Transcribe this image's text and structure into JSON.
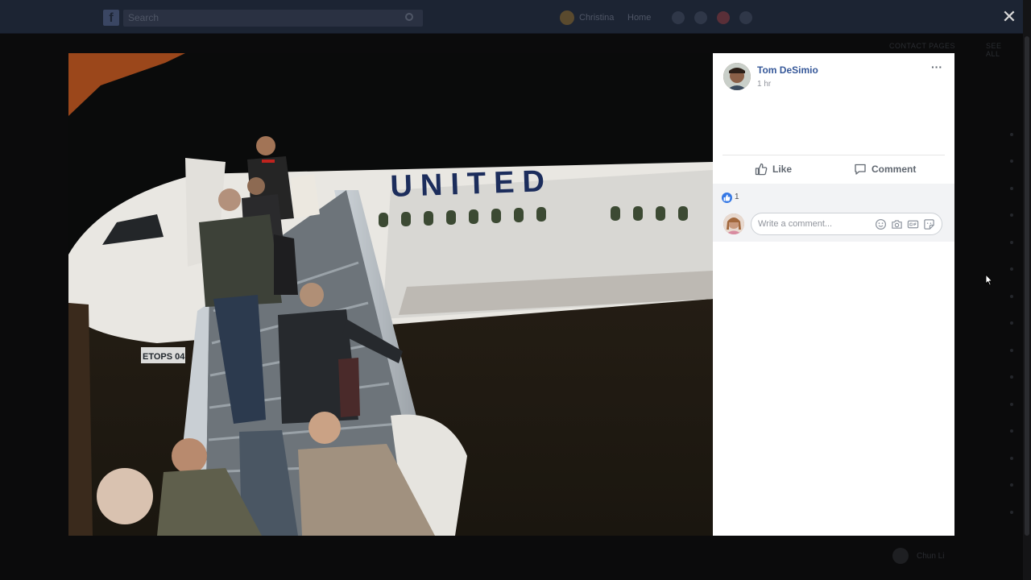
{
  "background": {
    "search_placeholder": "Search",
    "user_name": "Christina",
    "home_label": "Home",
    "contacts_header": "CONTACT PAGES",
    "see_all": "SEE ALL",
    "chat_user": "Chun Li"
  },
  "viewer": {
    "close_label": "✕"
  },
  "photo": {
    "airline_text": "UNITED",
    "tail_marking": "ETOPS 04"
  },
  "post": {
    "author": "Tom DeSimio",
    "time": "1 hr",
    "more_label": "···",
    "like_label": "Like",
    "comment_label": "Comment",
    "like_count": "1",
    "comment_placeholder": "Write a comment..."
  },
  "icons": {
    "like": "thumbs-up-icon",
    "comment": "speech-bubble-icon",
    "emoji": "smiley-icon",
    "camera": "camera-icon",
    "gif": "gif-icon",
    "sticker": "sticker-icon"
  },
  "colors": {
    "link_blue": "#365899",
    "like_blue": "#3578e5",
    "topbar": "#1c2433"
  }
}
